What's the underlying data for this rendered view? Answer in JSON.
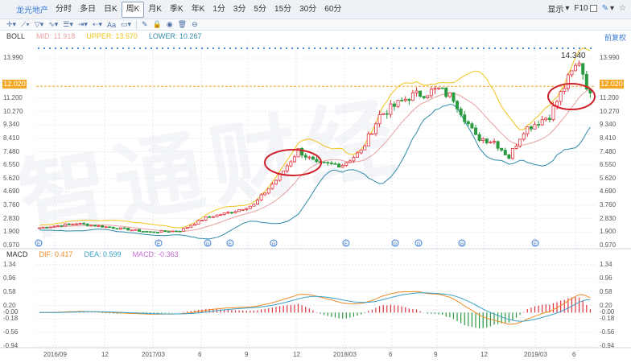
{
  "header": {
    "stock_name": "龙光地产",
    "tabs": [
      "分时",
      "多日",
      "日K",
      "周K",
      "月K",
      "季K",
      "年K",
      "1分",
      "3分",
      "5分",
      "15分",
      "30分",
      "60分"
    ],
    "active_tab": "周K",
    "display_label": "显示",
    "f10_label": "F10"
  },
  "boll": {
    "name": "BOLL",
    "mid": "MID: 11.918",
    "upper": "UPPER: 13.570",
    "lower": "LOWER: 10.267",
    "reset_label": "前复权",
    "last_price": "14.340",
    "marker_price": "12.020",
    "y_labels": [
      "13.990",
      "12.020",
      "11.200",
      "10.270",
      "9.340",
      "8.410",
      "7.480",
      "6.550",
      "5.620",
      "4.690",
      "3.760",
      "2.830",
      "1.900",
      "0.970"
    ]
  },
  "macd": {
    "name": "MACD",
    "dif": "DIF: 0.417",
    "dea": "DEA: 0.599",
    "macd": "MACD: -0.363",
    "y_labels": [
      "1.34",
      "0.96",
      "0.58",
      "0.20",
      "-0.00",
      "-0.18",
      "-0.56",
      "-0.94"
    ]
  },
  "x_labels": [
    "2016/09",
    "12",
    "2017/03",
    "6",
    "9",
    "12",
    "2018/03",
    "6",
    "9",
    "12",
    "2019/03",
    "6"
  ],
  "colors": {
    "up": "#e0313b",
    "down": "#2b9a3e",
    "upper_band": "#f0c419",
    "mid_band": "#e8a0a0",
    "lower_band": "#2f8aa8",
    "dif": "#f08a24",
    "dea": "#3aa0c8",
    "highlight": "#d0202a",
    "price_line": "#f5a623"
  },
  "watermark": "智通财经"
}
